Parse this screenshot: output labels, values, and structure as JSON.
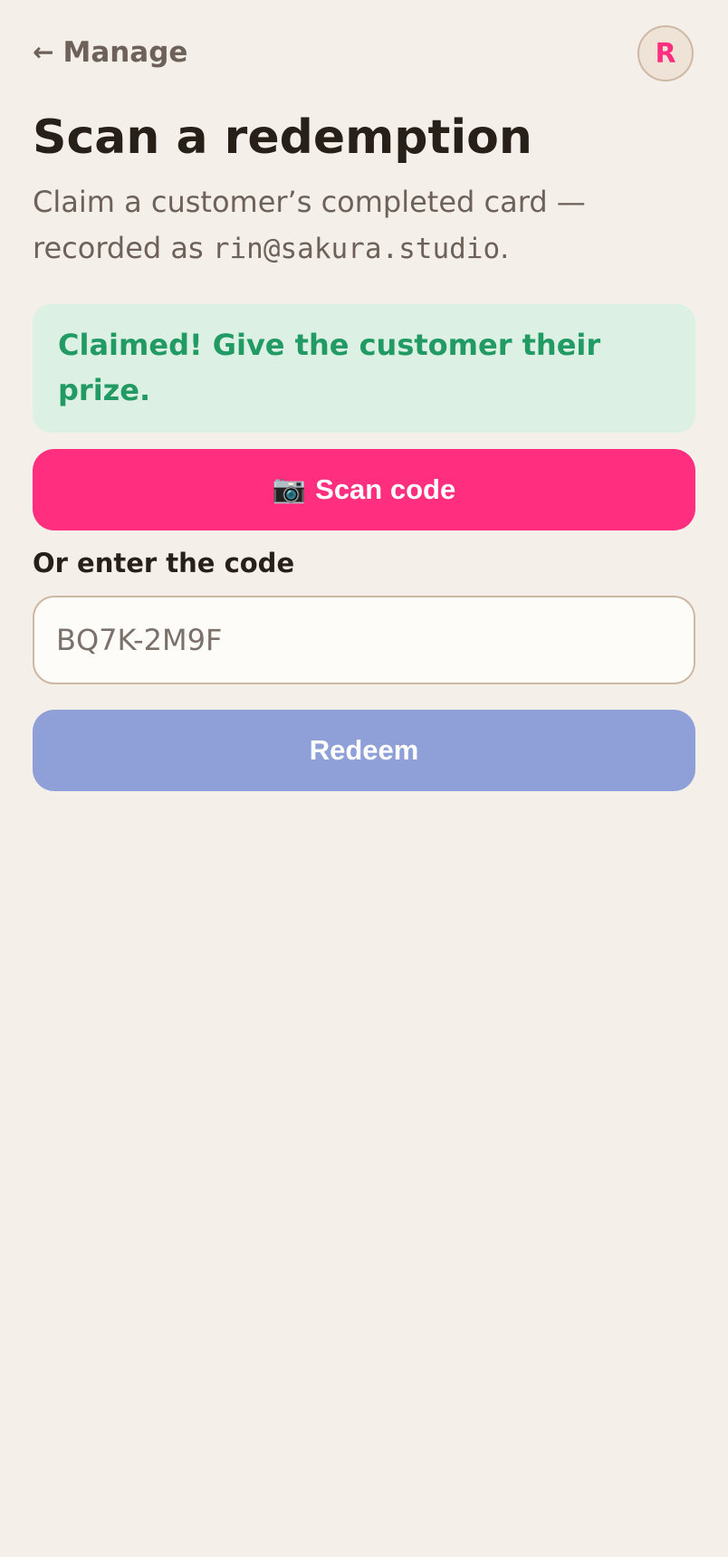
{
  "nav": {
    "back_arrow": "←",
    "back_label": "Manage"
  },
  "avatar": {
    "initial": "R"
  },
  "page": {
    "title": "Scan a redemption",
    "subtitle_prefix": "Claim a customer’s completed card — recorded as ",
    "subtitle_email": "rin@sakura.studio",
    "subtitle_suffix": "."
  },
  "banner": {
    "message": "Claimed! Give the customer their prize."
  },
  "scan": {
    "icon": "📷",
    "label": "Scan code"
  },
  "manual": {
    "label": "Or enter the code",
    "placeholder": "BQ7K-2M9F",
    "value": ""
  },
  "redeem": {
    "label": "Redeem"
  },
  "colors": {
    "background": "#f4efe9",
    "accent": "#ff2e7e",
    "success_text": "#219a64",
    "success_bg": "#dcf1e3",
    "redeem_disabled": "#8fa0d9",
    "muted_text": "#6d615a"
  },
  "icons": {
    "back": "arrow-left-icon",
    "scan": "camera-icon"
  }
}
